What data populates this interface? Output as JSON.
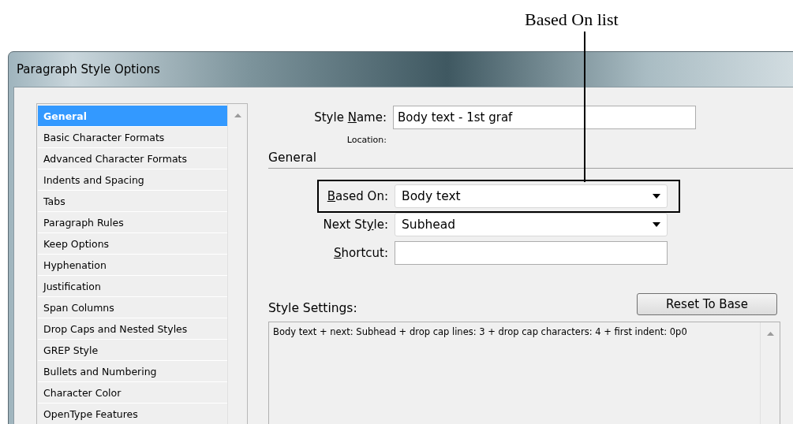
{
  "callout": {
    "text": "Based On list"
  },
  "window": {
    "title": "Paragraph Style Options"
  },
  "categories": [
    {
      "label": "General",
      "selected": true
    },
    {
      "label": "Basic Character Formats",
      "selected": false
    },
    {
      "label": "Advanced Character Formats",
      "selected": false
    },
    {
      "label": "Indents and Spacing",
      "selected": false
    },
    {
      "label": "Tabs",
      "selected": false
    },
    {
      "label": "Paragraph Rules",
      "selected": false
    },
    {
      "label": "Keep Options",
      "selected": false
    },
    {
      "label": "Hyphenation",
      "selected": false
    },
    {
      "label": "Justification",
      "selected": false
    },
    {
      "label": "Span Columns",
      "selected": false
    },
    {
      "label": "Drop Caps and Nested Styles",
      "selected": false
    },
    {
      "label": "GREP Style",
      "selected": false
    },
    {
      "label": "Bullets and Numbering",
      "selected": false
    },
    {
      "label": "Character Color",
      "selected": false
    },
    {
      "label": "OpenType Features",
      "selected": false
    }
  ],
  "style_name": {
    "label": {
      "pre": "Style ",
      "key": "N",
      "post": "ame:"
    },
    "value": "Body text - 1st graf"
  },
  "location": {
    "label": "Location:"
  },
  "section_title": "General",
  "fields": [
    {
      "kind": "dropdown",
      "label": {
        "key": "B",
        "post": "ased On:"
      },
      "value": "Body text",
      "highlighted": true
    },
    {
      "kind": "dropdown",
      "label": {
        "pre": "Next St",
        "key": "y",
        "post": "le:"
      },
      "value": "Subhead",
      "highlighted": false
    },
    {
      "kind": "text",
      "label": {
        "key": "S",
        "post": "hortcut:"
      },
      "highlighted": false
    }
  ],
  "style_settings": {
    "label": "Style Settings:",
    "button": "Reset To Base",
    "text": "Body text + next: Subhead + drop cap lines:  3 + drop cap characters:  4 + first indent: 0p0"
  }
}
